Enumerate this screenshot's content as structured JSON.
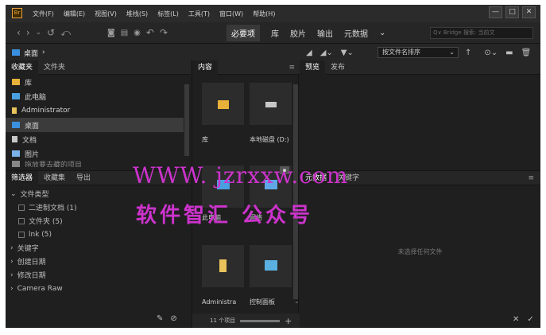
{
  "app": {
    "logo": "Br"
  },
  "menu": [
    "文件(F)",
    "编辑(E)",
    "视图(V)",
    "堆栈(S)",
    "标签(L)",
    "工具(T)",
    "窗口(W)",
    "帮助(H)"
  ],
  "window_controls": {
    "minimize": "—",
    "maximize": "□",
    "close": "✕"
  },
  "workspaces": {
    "items": [
      "必要项",
      "库",
      "胶片",
      "输出",
      "元数据"
    ],
    "active": "必要项",
    "more": "⌄"
  },
  "search": {
    "placeholder": "Q∨ Bridge 搜索: 当前文"
  },
  "path": {
    "current": "桌面",
    "arrow": "›"
  },
  "sort": {
    "label": "按文件名排序",
    "arrow": "⌄"
  },
  "favorites_panel": {
    "tabs": [
      "收藏夹",
      "文件夹"
    ],
    "items": [
      {
        "label": "库",
        "icon": "library-icon",
        "color": "#e8b23a"
      },
      {
        "label": "此电脑",
        "icon": "computer-icon",
        "color": "#4a9fe0"
      },
      {
        "label": "Administrator",
        "icon": "user-folder-icon",
        "color": "#e8c25a"
      },
      {
        "label": "桌面",
        "icon": "desktop-icon",
        "color": "#3b8fe0",
        "selected": true
      },
      {
        "label": "文档",
        "icon": "document-icon",
        "color": "#c8c8c8"
      },
      {
        "label": "图片",
        "icon": "pictures-icon",
        "color": "#7bb3e8"
      },
      {
        "label": "拖放要去藏的项目",
        "icon": "drop-icon",
        "color": "#888888"
      }
    ]
  },
  "filter_panel": {
    "tabs": [
      "筛选器",
      "收藏集",
      "导出"
    ],
    "sections": [
      {
        "label": "文件类型",
        "expanded": true,
        "items": [
          "二进制文档 (1)",
          "文件夹 (5)",
          "lnk (5)"
        ]
      },
      {
        "label": "关键字",
        "expanded": false
      },
      {
        "label": "创建日期",
        "expanded": false
      },
      {
        "label": "修改日期",
        "expanded": false
      },
      {
        "label": "Camera Raw",
        "expanded": false
      }
    ]
  },
  "content_panel": {
    "tab": "内容",
    "items": [
      {
        "label": "库",
        "icon": "library-folder-icon"
      },
      {
        "label": "本地磁盘 (D:)",
        "icon": "disk-icon"
      },
      {
        "label": "此电脑",
        "icon": "computer-icon"
      },
      {
        "label": "网络",
        "icon": "network-icon"
      },
      {
        "label": "Administra",
        "icon": "user-folder-icon"
      },
      {
        "label": "控制面板",
        "icon": "control-panel-icon"
      }
    ],
    "footer": {
      "count": "11 个项目"
    }
  },
  "preview_panel": {
    "tabs": [
      "预览",
      "发布"
    ]
  },
  "metadata_panel": {
    "tabs": [
      "元数据",
      "关键字"
    ],
    "empty": "未选择任何文件"
  },
  "watermark": {
    "line1": "WWW. jzrxxw.com",
    "line2": "软件智汇 公众号"
  },
  "colors": {
    "accent": "#3b8fe0",
    "watermark": "#cc33cc",
    "brand": "#e8a23a"
  }
}
